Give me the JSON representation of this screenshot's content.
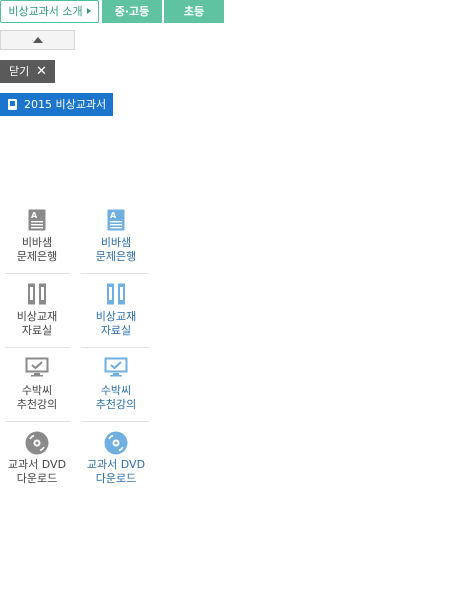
{
  "tabs": {
    "intro_label": "비상교과서 소개",
    "middle_high_label": "중·고등",
    "elementary_label": "초등"
  },
  "close": {
    "label": "닫기"
  },
  "book": {
    "label": "2015 비상교과서"
  },
  "menu": [
    {
      "line1": "비바샘",
      "line2": "문제은행",
      "icon": "question-bank-icon"
    },
    {
      "line1": "비상교재",
      "line2": "자료실",
      "icon": "binder-icon"
    },
    {
      "line1": "수박씨",
      "line2": "추천강의",
      "icon": "monitor-check-icon"
    },
    {
      "line1": "교과서 DVD",
      "line2": "다운로드",
      "icon": "disc-icon"
    }
  ],
  "colors": {
    "tab_green": "#5fc3a2",
    "close_gray": "#5a5a5a",
    "book_blue": "#1b75cc",
    "icon_gray": "#8a8a8a",
    "icon_blue": "#6fb0e0"
  }
}
